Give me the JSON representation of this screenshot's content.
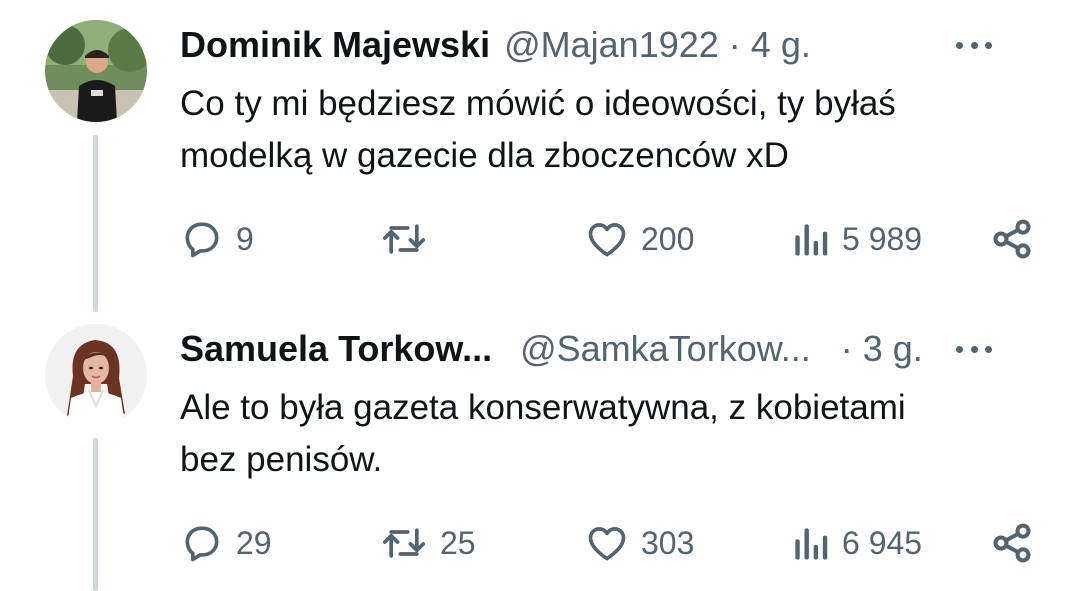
{
  "tweets": [
    {
      "name": "Dominik Majewski",
      "handle": "@Majan1922",
      "separator": "·",
      "time": "4 g.",
      "text_lines": [
        "Co ty mi będziesz mówić o ideowości, ty byłaś",
        "modelką w gazecie dla zboczenców xD"
      ],
      "replies": "9",
      "retweets": "",
      "likes": "200",
      "views": "5 989"
    },
    {
      "name": "Samuela Torkow...",
      "handle": "@SamkaTorkow...",
      "separator": "·",
      "time": "3 g.",
      "text_lines": [
        "Ale to była gazeta konserwatywna, z kobietami",
        "bez penisów."
      ],
      "replies": "29",
      "retweets": "25",
      "likes": "303",
      "views": "6 945"
    }
  ],
  "colors": {
    "text": "#0f1419",
    "muted": "#536471",
    "thread_line": "#cfd9de"
  },
  "icons": [
    "reply-icon",
    "retweet-icon",
    "like-icon",
    "views-icon",
    "share-icon",
    "more-icon"
  ]
}
